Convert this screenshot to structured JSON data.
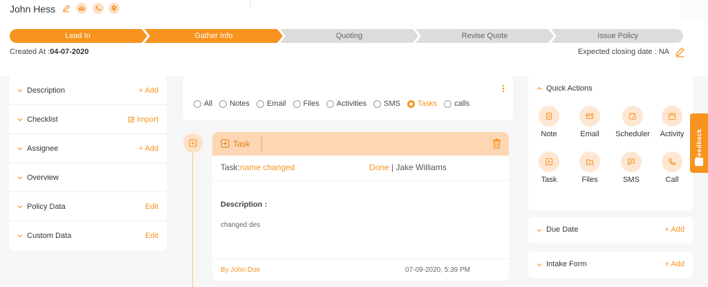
{
  "header": {
    "name": "John Hess",
    "created_label": "Created At :",
    "created_value": "04-07-2020",
    "expected_label": "Expected closing date :",
    "expected_value": "NA"
  },
  "pipeline": {
    "stages": [
      {
        "label": "Lead In",
        "active": true
      },
      {
        "label": "Gather Info",
        "active": true
      },
      {
        "label": "Quoting",
        "active": false
      },
      {
        "label": "Revise Quote",
        "active": false
      },
      {
        "label": "Issue Policy",
        "active": false
      }
    ]
  },
  "left_panel": {
    "rows": [
      {
        "label": "Description",
        "action": "+ Add"
      },
      {
        "label": "Checklist",
        "action": "Import"
      },
      {
        "label": "Assignee",
        "action": "+ Add"
      },
      {
        "label": "Overview",
        "action": ""
      },
      {
        "label": "Policy Data",
        "action": "Edit"
      },
      {
        "label": "Custom Data",
        "action": "Edit"
      }
    ]
  },
  "filters": {
    "options": [
      "All",
      "Notes",
      "Email",
      "Files",
      "Activities",
      "SMS",
      "Tasks",
      "calls"
    ],
    "selected": "Tasks"
  },
  "task": {
    "header_title": "Task",
    "task_label": "Task:",
    "task_value": "name changed",
    "status": "Done",
    "assignee": "Jake Williams",
    "description_label": "Description :",
    "description_text": "changed des",
    "by_line": "By John Doe",
    "timestamp": "07-09-2020, 5:39 PM"
  },
  "quick_actions": {
    "title": "Quick Actions",
    "items": [
      "Note",
      "Email",
      "Scheduler",
      "Activity",
      "Task",
      "Files",
      "SMS",
      "Call"
    ]
  },
  "side_rows": {
    "due_date": {
      "label": "Due Date",
      "action": "+ Add"
    },
    "intake_form": {
      "label": "Intake Form",
      "action": "+ Add"
    }
  },
  "feedback": {
    "label": "Feedback"
  },
  "colors": {
    "accent": "#f7931e",
    "accent_light": "#fde0c7",
    "stage_idle": "#dcdcdc"
  }
}
